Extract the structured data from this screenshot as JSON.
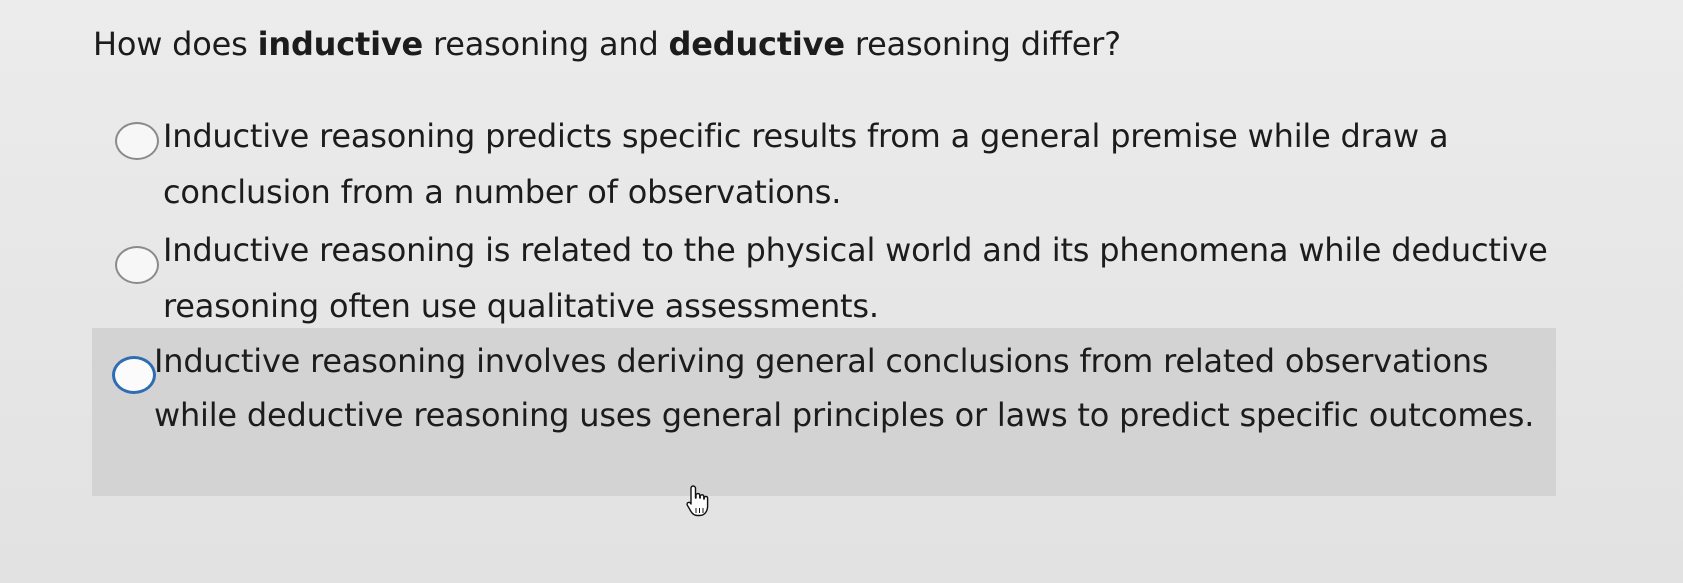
{
  "question": {
    "prefix": "How does ",
    "bold1": "inductive",
    "middle": " reasoning and ",
    "bold2": "deductive",
    "suffix": " reasoning differ?"
  },
  "options": [
    {
      "text": "Inductive reasoning predicts specific results from a general premise while draw a conclusion from a number of observations.",
      "selected": false
    },
    {
      "text": "Inductive reasoning is related to the physical world and its phenomena while deductive reasoning often use qualitative assessments.",
      "selected": false
    },
    {
      "text": "Inductive reasoning involves deriving general conclusions from related observations while deductive reasoning uses general principles or laws to predict specific outcomes.",
      "selected": false,
      "hovered": true
    }
  ],
  "colors": {
    "hover_background": "#d3d3d3",
    "focus_ring": "#2f6db3",
    "radio_border": "#8a8a8a"
  },
  "icons": {
    "cursor": "hand-pointer-icon"
  }
}
